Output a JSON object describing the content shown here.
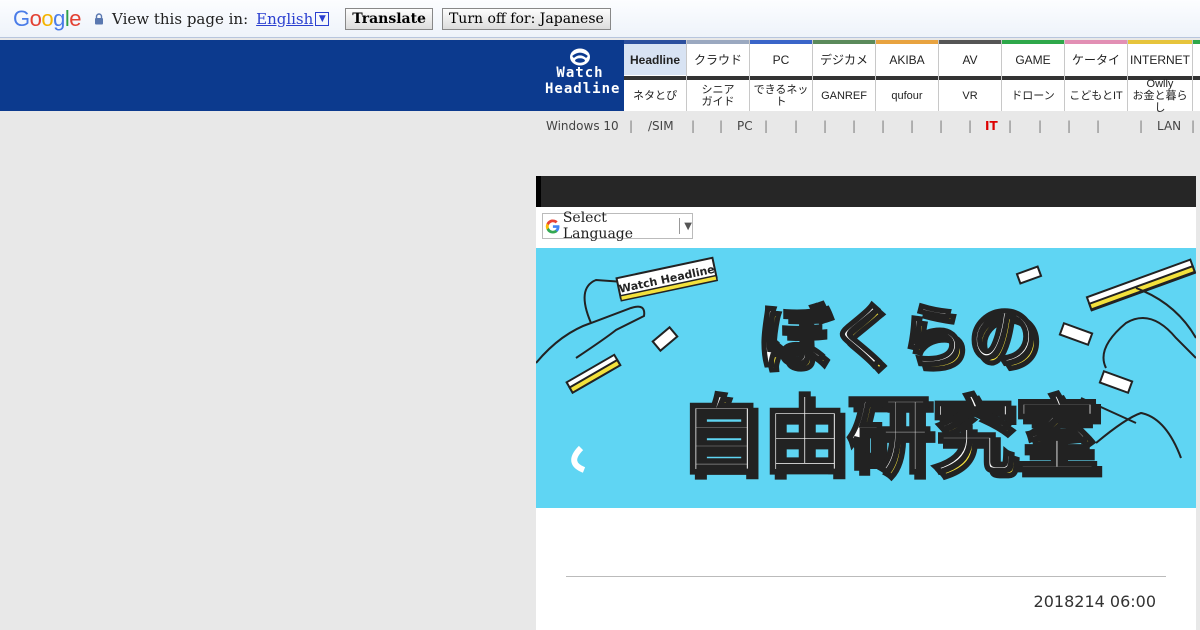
{
  "translate_bar": {
    "google_logo": "Google",
    "view_label": "View this page in:",
    "language": "English",
    "translate_button": "Translate",
    "turn_off_button": "Turn off for: Japanese"
  },
  "site": {
    "logo_line1": "Watch",
    "logo_line2": "Headline"
  },
  "nav": {
    "top": [
      {
        "label": "Headline",
        "color": "#2b4f9e",
        "active": true
      },
      {
        "label": "クラウド",
        "color": "#9aa8c0"
      },
      {
        "label": "PC",
        "color": "#3a65c9"
      },
      {
        "label": "デジカメ",
        "color": "#5b8a5b"
      },
      {
        "label": "AKIBA",
        "color": "#e8a340"
      },
      {
        "label": "AV",
        "color": "#555555"
      },
      {
        "label": "GAME",
        "color": "#2ea84a"
      },
      {
        "label": "ケータイ",
        "color": "#e28fb4"
      },
      {
        "label": "INTERNET",
        "color": "#e6c43c"
      }
    ],
    "bottom": [
      {
        "label1": "ネタとぴ"
      },
      {
        "label1": "シニア",
        "label2": "ガイド"
      },
      {
        "label1": "できるネット"
      },
      {
        "label1": "GANREF"
      },
      {
        "label1": "qufour"
      },
      {
        "label1": "VR"
      },
      {
        "label1": "ドローン"
      },
      {
        "label1": "こどもとIT"
      },
      {
        "label1": "Owlly",
        "label2": "お金と暮らし"
      }
    ]
  },
  "subnav": [
    "Windows 10",
    "/SIM",
    "PC",
    "IT",
    "LAN"
  ],
  "panel": {
    "select_language": "Select Language",
    "date": "2018214 06:00"
  },
  "banner": {
    "badge": "Watch Headline",
    "title_line1": "ぼくらの",
    "title_line2": "自由研究室"
  }
}
